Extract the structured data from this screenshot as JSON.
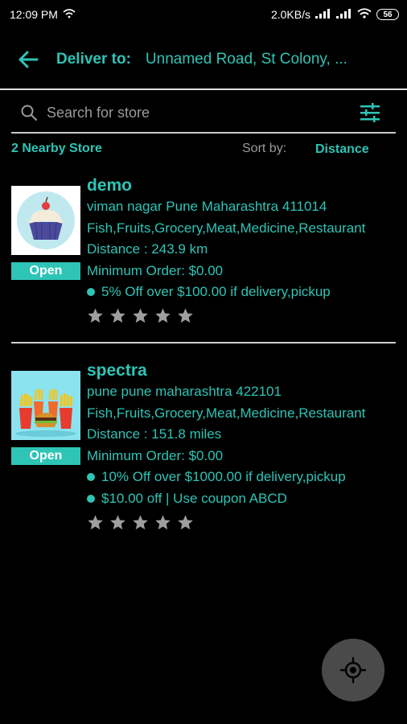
{
  "status_bar": {
    "time": "12:09 PM",
    "speed": "2.0KB/s",
    "battery": "56"
  },
  "header": {
    "back_icon": "arrow-left-icon",
    "deliver_label": "Deliver to:",
    "address": "Unnamed Road, St Colony, ..."
  },
  "search": {
    "placeholder": "Search for store",
    "value": "",
    "filter_icon": "sliders-icon"
  },
  "list_header": {
    "count_text": "2 Nearby Store",
    "sort_label": "Sort by:",
    "sort_value": "Distance"
  },
  "stores": [
    {
      "name": "demo",
      "address": "viman nagar Pune Maharashtra 411014",
      "categories": "Fish,Fruits,Grocery,Meat,Medicine,Restaurant",
      "distance": "Distance : 243.9 km",
      "min_order": "Minimum Order: $0.00",
      "offers": [
        "5% Off over $100.00 if delivery,pickup"
      ],
      "status": "Open",
      "rating": 0,
      "image": "cupcake-image"
    },
    {
      "name": "spectra",
      "address": "pune pune maharashtra 422101",
      "categories": "Fish,Fruits,Grocery,Meat,Medicine,Restaurant",
      "distance": "Distance : 151.8 miles",
      "min_order": "Minimum Order: $0.00",
      "offers": [
        "10% Off over $1000.00 if delivery,pickup",
        "$10.00 off | Use coupon ABCD"
      ],
      "status": "Open",
      "rating": 0,
      "image": "fast-food-image"
    }
  ],
  "fab": {
    "icon": "locate-icon"
  },
  "colors": {
    "accent": "#2ec4b6",
    "background": "#000000",
    "muted": "#9a9a9a",
    "star": "#9e9e9e",
    "fab": "#4a4a4a"
  }
}
